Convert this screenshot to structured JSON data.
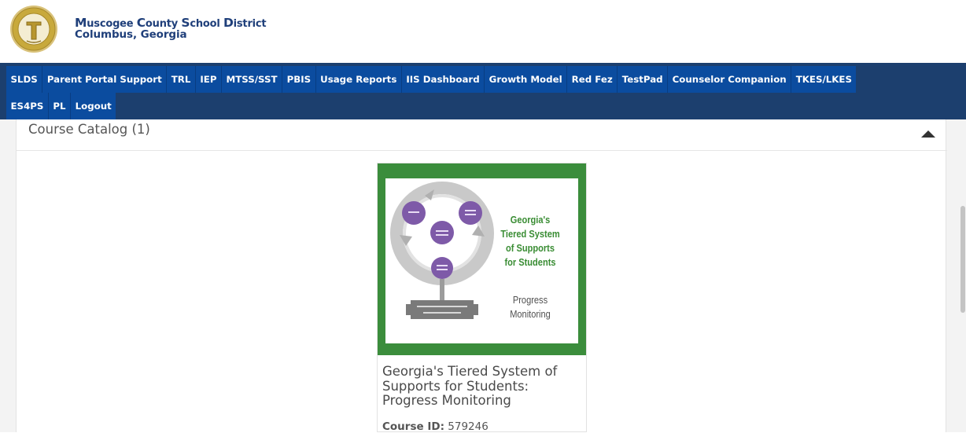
{
  "header": {
    "district": {
      "word1_cap": "M",
      "word1_rest": "uscogee ",
      "word2_cap": "C",
      "word2_rest": "ounty ",
      "word3_cap": "S",
      "word3_rest": "chool ",
      "word4_cap": "D",
      "word4_rest": "istrict"
    },
    "city": "Columbus, Georgia",
    "seal_icon": "school-district-seal",
    "seal_color": "#c8a93c"
  },
  "nav": {
    "row1": [
      {
        "label": "SLDS"
      },
      {
        "label": "Parent Portal Support"
      },
      {
        "label": "TRL"
      },
      {
        "label": "IEP"
      },
      {
        "label": "MTSS/SST"
      },
      {
        "label": "PBIS"
      },
      {
        "label": "Usage Reports"
      },
      {
        "label": "IIS Dashboard"
      },
      {
        "label": "Growth Model"
      },
      {
        "label": "Red Fez"
      },
      {
        "label": "TestPad"
      },
      {
        "label": "Counselor Companion"
      },
      {
        "label": "TKES/LKES"
      }
    ],
    "row2": [
      {
        "label": "ES4PS"
      },
      {
        "label": "PL"
      },
      {
        "label": "Logout"
      }
    ],
    "bar_color": "#1c3f6e",
    "item_color": "#0b4c9f"
  },
  "catalog": {
    "title": "Course Catalog (1)",
    "toggle_icon": "caret-up-icon"
  },
  "course": {
    "thumbnail": {
      "title_lines": [
        "Georgia's",
        "Tiered System",
        "of Supports",
        "for Students"
      ],
      "subtitle_lines": [
        "Progress",
        "Monitoring"
      ],
      "frame_color": "#3b8d3c",
      "accent_color": "#7e5aa8"
    },
    "title": "Georgia's Tiered System of Supports for Students: Progress Monitoring",
    "id_label": "Course ID:",
    "id_value": "579246"
  }
}
